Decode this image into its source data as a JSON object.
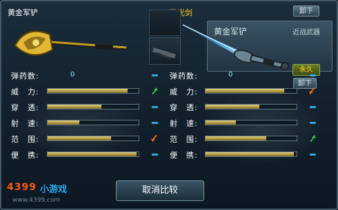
{
  "left_weapon": {
    "name": "黄金军铲"
  },
  "right_weapon": {
    "name": "激光剑"
  },
  "equipped_panel": {
    "title": "黄金军铲",
    "type": "近战武器",
    "unload_label": "卸下",
    "perm_label": "永久",
    "unload_label2": "卸下"
  },
  "stats": [
    {
      "label": "弹药数:",
      "left_value": "0",
      "right_value": "0"
    },
    {
      "label": "威　力:",
      "left_fill": 0.88,
      "right_fill": 0.86,
      "left_indicator": "up-arrow",
      "right_indicator": "down-arrow"
    },
    {
      "label": "穿　透:",
      "left_fill": 0.59,
      "right_fill": 0.59,
      "left_indicator": "dash",
      "right_indicator": "dash"
    },
    {
      "label": "射　速:",
      "left_fill": 0.35,
      "right_fill": 0.33,
      "left_indicator": "dash",
      "right_indicator": "dash"
    },
    {
      "label": "范　围:",
      "left_fill": 0.7,
      "right_fill": 0.67,
      "left_indicator": "down-arrow",
      "right_indicator": "up-arrow"
    },
    {
      "label": "便　携:",
      "left_fill": 0.98,
      "right_fill": 0.97,
      "left_indicator": "dash",
      "right_indicator": "dash"
    }
  ],
  "cancel_button": "取消比较",
  "watermark": {
    "logo": "4399",
    "logo_cn": "小游戏",
    "url": "www.4399.com"
  },
  "colors": {
    "bar_fill": "#c2a94f",
    "up_arrow": "#39c64a",
    "down_arrow": "#ff6a1a",
    "dash": "#37a7d8"
  }
}
